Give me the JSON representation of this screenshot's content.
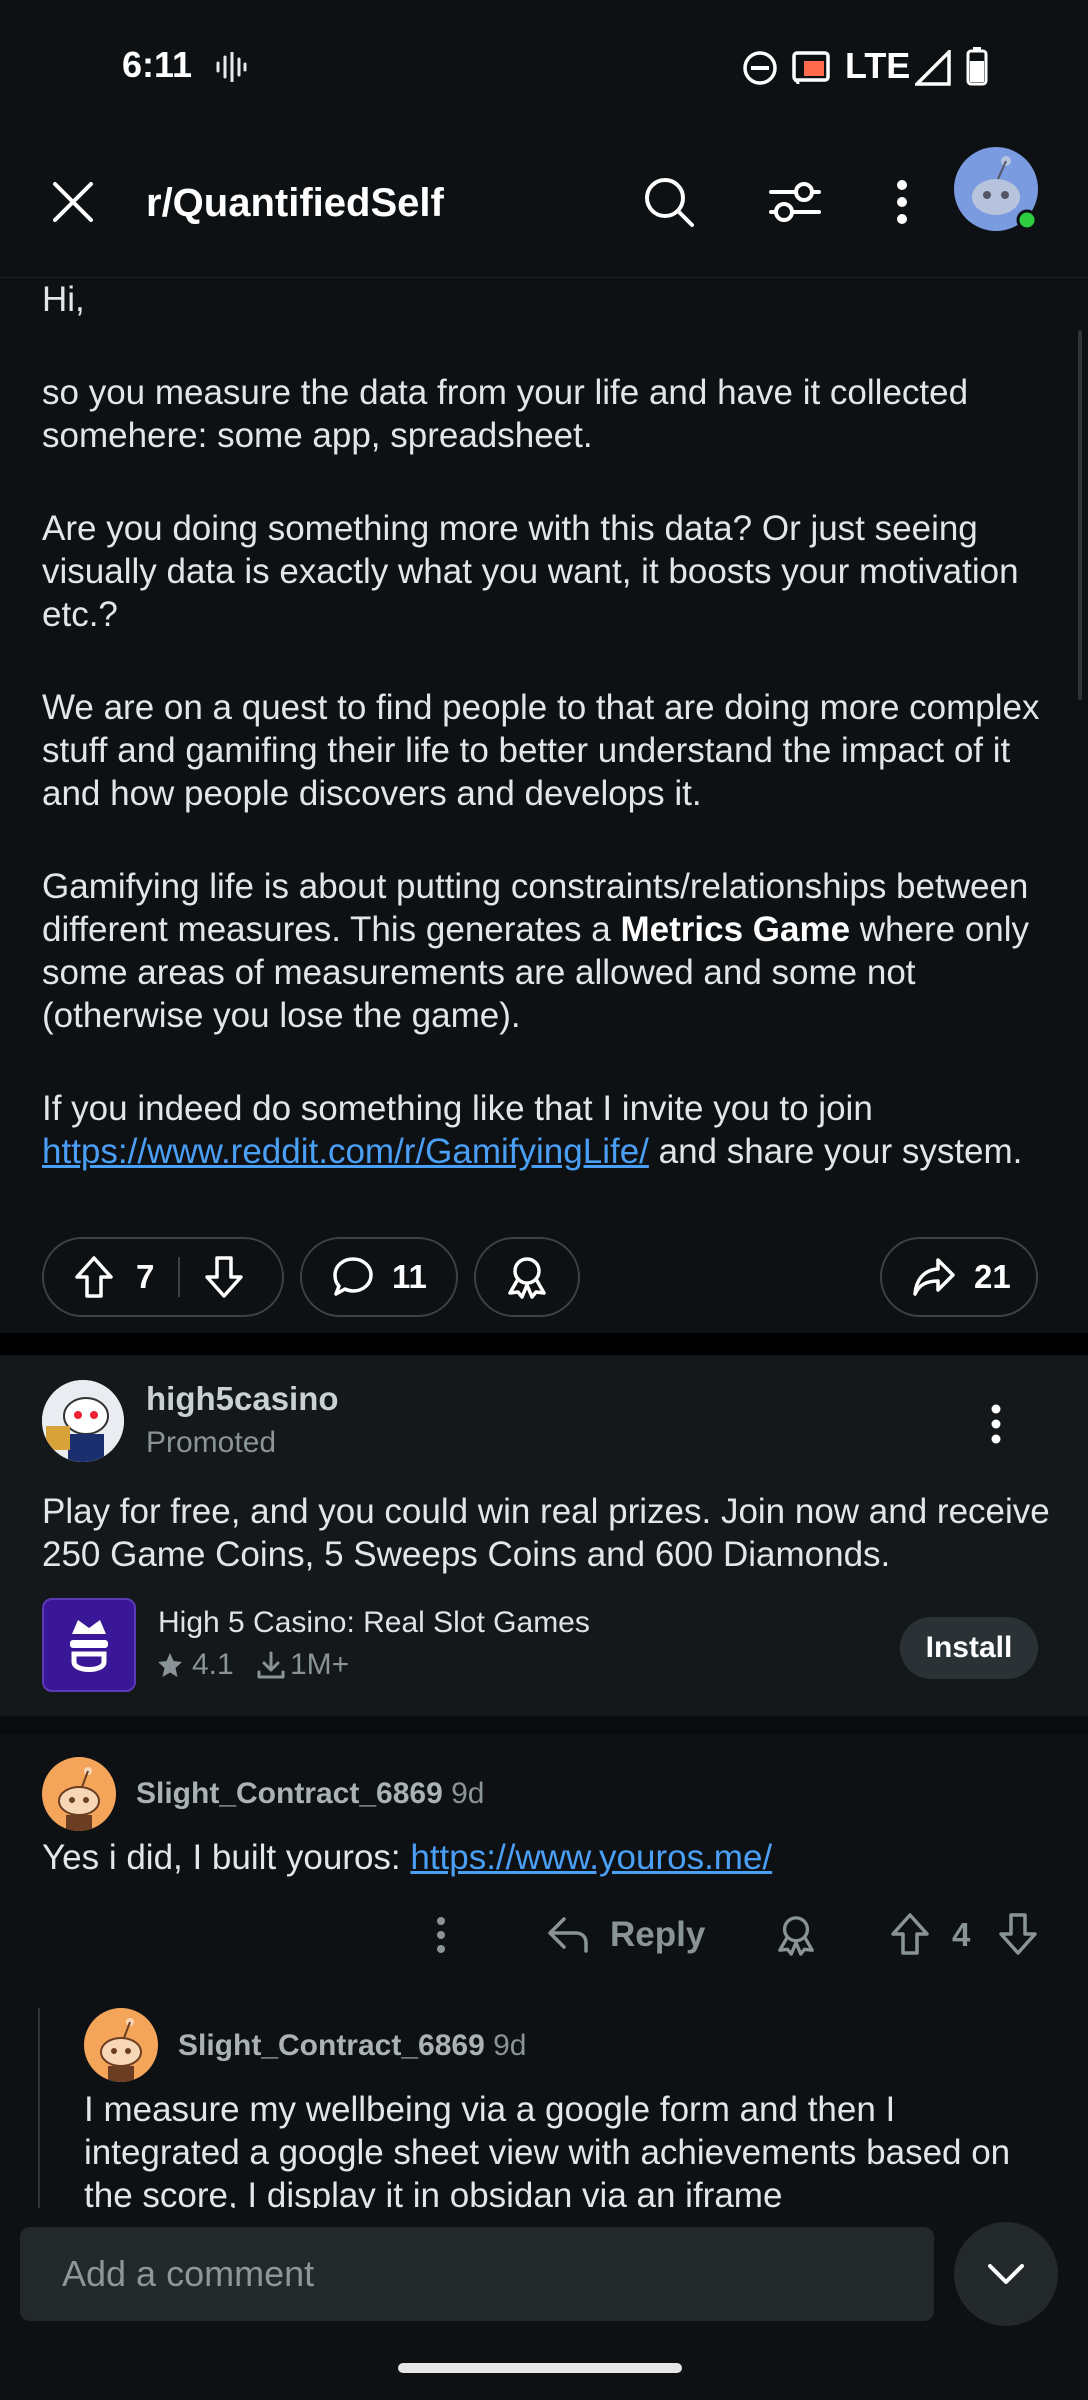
{
  "status_bar": {
    "time": "6:11",
    "network": "LTE"
  },
  "app_bar": {
    "subreddit": "r/QuantifiedSelf"
  },
  "post": {
    "greeting": "Hi,",
    "p1": "so you measure the data from your life and have it collected somehere: some app, spreadsheet.",
    "p2": "Are you doing something more with this data? Or just seeing visually data is exactly what you want, it boosts your motivation etc.?",
    "p3": "We are on a quest to find people to that are doing more complex stuff and gamifing their life to better understand the impact of it and how people discovers and develops it.",
    "p4_before": "Gamifying life is about putting constraints/relationships between different measures. This generates a ",
    "p4_bold": "Metrics Game",
    "p4_after": " where only some areas of measurements are allowed and some not (otherwise you lose the game).",
    "p5_before": "If you indeed do something like that I invite you to join ",
    "p5_link": "https://www.reddit.com/r/GamifyingLife/",
    "p5_after": " and share your system.",
    "votes": "7",
    "comments": "11",
    "shares": "21"
  },
  "ad": {
    "advertiser": "high5casino",
    "promoted_label": "Promoted",
    "text": "Play for free, and you could win real prizes. Join now and receive 250 Game Coins, 5 Sweeps Coins and 600 Diamonds.",
    "app_name": "High 5 Casino: Real Slot Games",
    "rating": "4.1",
    "downloads": "1M+",
    "install_label": "Install"
  },
  "comments": [
    {
      "user": "Slight_Contract_6869",
      "age": "9d",
      "text_before": "Yes i did, I built youros: ",
      "link": "https://www.youros.me/",
      "reply_label": "Reply",
      "votes": "4"
    },
    {
      "user": "Slight_Contract_6869",
      "age": "9d",
      "text": "I measure my wellbeing via a google form and then I integrated a google sheet view with achievements based on the score, I display it in obsidan via an iframe"
    }
  ],
  "composer": {
    "placeholder": "Add a comment"
  },
  "colors": {
    "background": "#0e1113",
    "link": "#4a9ff7",
    "avatar_orange": "#f5a55a",
    "online_dot": "#2ecc40"
  }
}
